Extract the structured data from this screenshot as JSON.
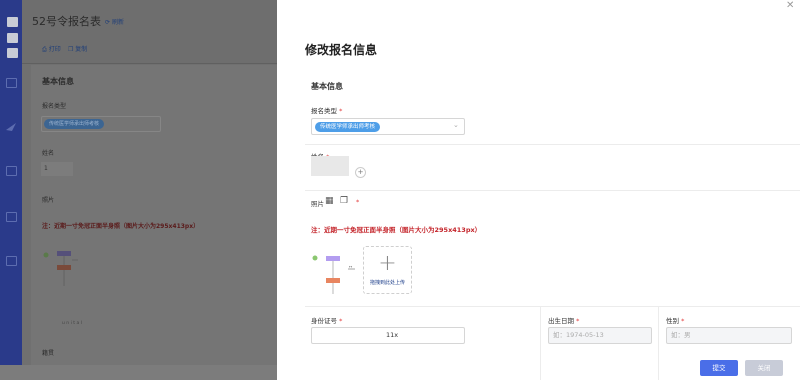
{
  "background": {
    "title": "52号令报名表",
    "refresh": "刷新",
    "print": "打印",
    "copy": "复制",
    "section": "基本信息",
    "registration_type_label": "报名类型",
    "registration_type_tag": "传统医学师承出师考核",
    "name_label": "姓名",
    "name_value": "1",
    "photo_label": "照片",
    "photo_note": "注：近期一寸免冠正面半身照（图片大小为295x413px）",
    "diagram_caption": "u n i t a l",
    "bottom_label": "籍贯"
  },
  "panel": {
    "title": "修改报名信息",
    "section": "基本信息",
    "registration_type_label": "报名类型",
    "registration_type_tag": "传统医学师承出师考核",
    "name_label": "姓名",
    "photo_label": "照片",
    "photo_note": "注：近期一寸免冠正面半身照（图片大小为295x413px）",
    "upload_text": "拖拽到此处上传",
    "id_label": "身份证号",
    "id_value": "11x",
    "birth_label": "出生日期",
    "birth_placeholder": "如：1974-05-13",
    "gender_label": "性别",
    "gender_placeholder": "如：男",
    "required_mark": "*",
    "submit": "提交",
    "close": "关闭"
  },
  "colors": {
    "primary": "#4a6ee8",
    "required": "#e23b3b",
    "note_red": "#c4242a",
    "sidebar": "#2a3a8a"
  }
}
